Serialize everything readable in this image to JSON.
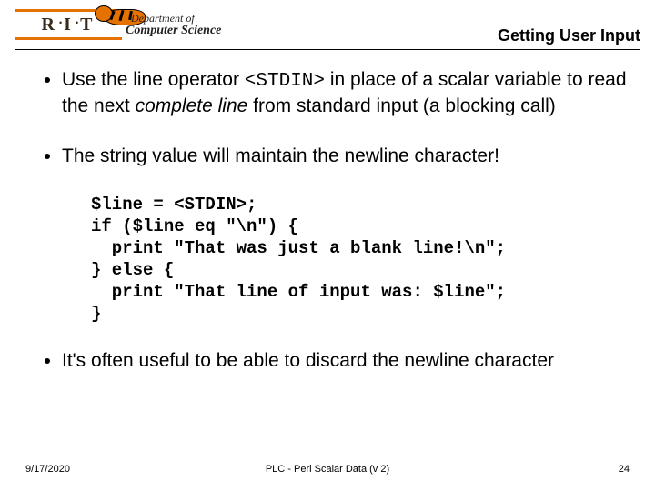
{
  "header": {
    "logo_text": "R · I · T",
    "dept_line1": "Department of",
    "dept_line2": "Computer Science",
    "title": "Getting User Input"
  },
  "bullets": {
    "b1_pre": "Use the line operator ",
    "b1_code": "<STDIN>",
    "b1_mid": " in place of a scalar variable to read the next ",
    "b1_ital": "complete line",
    "b1_post": " from standard input (a blocking call)",
    "b2": "The string value will maintain the newline character!",
    "b3": "It's often useful to be able to discard the newline character"
  },
  "code": "$line = <STDIN>;\nif ($line eq \"\\n\") {\n  print \"That was just a blank line!\\n\";\n} else {\n  print \"That line of input was: $line\";\n}",
  "footer": {
    "date": "9/17/2020",
    "mid": "PLC - Perl Scalar Data (v 2)",
    "page": "24"
  }
}
